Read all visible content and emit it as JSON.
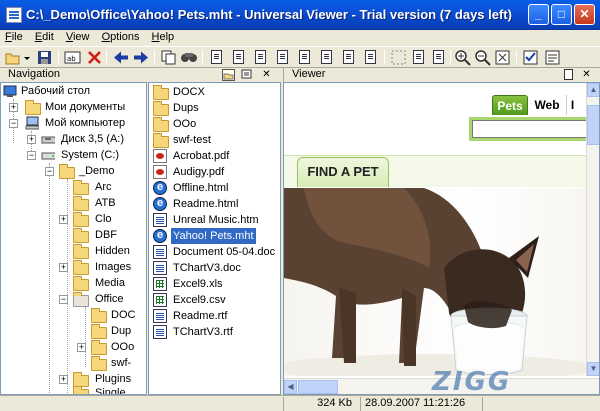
{
  "window": {
    "title": "C:\\_Demo\\Office\\Yahoo! Pets.mht - Universal Viewer - Trial version (7 days left)",
    "minimize_glyph": "_",
    "maximize_glyph": "□",
    "close_glyph": "✕"
  },
  "menu": [
    "File",
    "Edit",
    "View",
    "Options",
    "Help"
  ],
  "toolbar_icons": [
    "open-folder-icon",
    "save-icon",
    "text-mode-icon",
    "delete-icon",
    "back-arrow-icon",
    "forward-arrow-icon",
    "copy-icon",
    "find-icon",
    "page-icon",
    "page-icon",
    "page-icon",
    "page-icon",
    "page-icon",
    "page-icon",
    "page-icon",
    "zoom-in-icon",
    "zoom-out-icon",
    "fit-icon",
    "options-icon",
    "properties-icon"
  ],
  "navigation": {
    "header": "Navigation",
    "tree": [
      {
        "label": "Рабочий стол"
      },
      {
        "label": "Мои документы"
      },
      {
        "label": "Мой компьютер"
      },
      {
        "label": "Диск 3,5 (A:)"
      },
      {
        "label": "System (C:)"
      },
      {
        "label": "_Demo"
      },
      {
        "label": "Arc"
      },
      {
        "label": "ATB"
      },
      {
        "label": "Clo"
      },
      {
        "label": "DBF"
      },
      {
        "label": "Hidden"
      },
      {
        "label": "Images"
      },
      {
        "label": "Media"
      },
      {
        "label": "Office"
      },
      {
        "label": "DOC"
      },
      {
        "label": "Dup"
      },
      {
        "label": "OOo"
      },
      {
        "label": "swf-"
      },
      {
        "label": "Plugins"
      },
      {
        "label": "Single"
      }
    ]
  },
  "files": [
    {
      "name": "DOCX",
      "type": "folder"
    },
    {
      "name": "Dups",
      "type": "folder"
    },
    {
      "name": "OOo",
      "type": "folder"
    },
    {
      "name": "swf-test",
      "type": "folder"
    },
    {
      "name": "Acrobat.pdf",
      "type": "pdf"
    },
    {
      "name": "Audigy.pdf",
      "type": "pdf"
    },
    {
      "name": "Offline.html",
      "type": "html"
    },
    {
      "name": "Readme.html",
      "type": "html"
    },
    {
      "name": "Unreal Music.htm",
      "type": "doc"
    },
    {
      "name": "Yahoo! Pets.mht",
      "type": "html",
      "selected": true
    },
    {
      "name": "Document 05-04.doc",
      "type": "doc"
    },
    {
      "name": "TChartV3.doc",
      "type": "doc"
    },
    {
      "name": "Excel9.xls",
      "type": "xls"
    },
    {
      "name": "Excel9.csv",
      "type": "xls"
    },
    {
      "name": "Readme.rtf",
      "type": "doc"
    },
    {
      "name": "TChartV3.rtf",
      "type": "doc"
    }
  ],
  "viewer": {
    "header": "Viewer",
    "tabs": [
      "Pets",
      "Web",
      "I"
    ],
    "find_tab": "FIND A PET"
  },
  "status": {
    "size": "324 Kb",
    "datetime": "28.09.2007 11:21:26"
  },
  "watermark": "ZIGG",
  "colors": {
    "titlebar": "#0a4fd6",
    "selection": "#316ac5",
    "web_green": "#6fae2c"
  }
}
